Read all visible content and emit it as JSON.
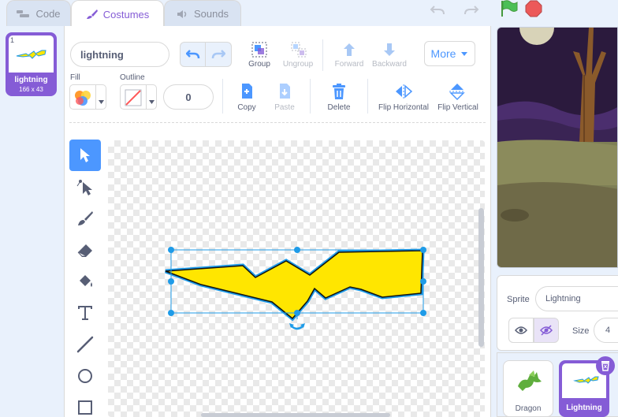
{
  "tabs": [
    {
      "label": "Code",
      "icon": "code-icon"
    },
    {
      "label": "Costumes",
      "icon": "brush-icon"
    },
    {
      "label": "Sounds",
      "icon": "speaker-icon"
    }
  ],
  "costume": {
    "number": "1",
    "name": "lightning",
    "size": "166 x 43"
  },
  "editor": {
    "costume_name": "lightning",
    "group_label": "Group",
    "ungroup_label": "Ungroup",
    "forward_label": "Forward",
    "backward_label": "Backward",
    "more_label": "More",
    "fill_label": "Fill",
    "outline_label": "Outline",
    "outline_width": "0",
    "copy_label": "Copy",
    "paste_label": "Paste",
    "delete_label": "Delete",
    "flip_h_label": "Flip Horizontal",
    "flip_v_label": "Flip Vertical"
  },
  "tools": [
    "select-tool",
    "reshape-tool",
    "brush-tool",
    "eraser-tool",
    "fill-tool",
    "text-tool",
    "line-tool",
    "circle-tool",
    "rectangle-tool"
  ],
  "sprite_info": {
    "sprite_label": "Sprite",
    "sprite_name": "Lightning",
    "size_label": "Size",
    "size_value": "4"
  },
  "sprites": [
    {
      "name": "Dragon"
    },
    {
      "name": "Lightning"
    }
  ],
  "colors": {
    "accent": "#855cd6",
    "blue": "#4c97ff",
    "lightning_fill": "#ffe600",
    "lightning_stroke": "#1e9be8"
  }
}
